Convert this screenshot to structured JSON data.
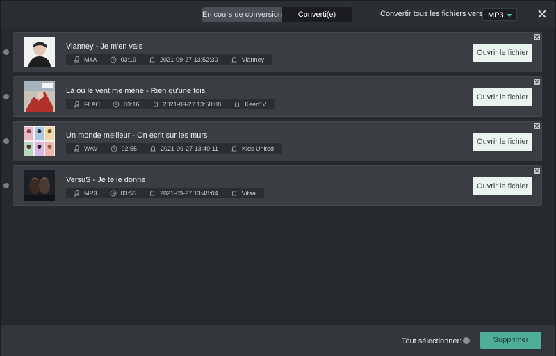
{
  "header": {
    "tabs": [
      {
        "label": "En cours de conversion",
        "active": false
      },
      {
        "label": "Converti(e)",
        "active": true
      }
    ],
    "convert_all_label": "Convertir tous les fichiers vers:",
    "format": "MP3",
    "accent": "#4fc3a0"
  },
  "items": [
    {
      "title": "Vianney - Je m'en vais",
      "format": "M4A",
      "duration": "03:19",
      "date": "2021-09-27 13:52:30",
      "artist": "Vianney",
      "open_label": "Ouvrir le fichier"
    },
    {
      "title": "Là où le vent me mène - Rien qu'une fois",
      "format": "FLAC",
      "duration": "03:16",
      "date": "2021-09-27 13:50:08",
      "artist": "Keen' V",
      "open_label": "Ouvrir le fichier"
    },
    {
      "title": "Un monde meilleur - On écrit sur les murs",
      "format": "WAV",
      "duration": "02:55",
      "date": "2021-09-27 13:49:11",
      "artist": "Kids United",
      "open_label": "Ouvrir le fichier"
    },
    {
      "title": "VersuS - Je te le donne",
      "format": "MP3",
      "duration": "03:55",
      "date": "2021-09-27 13:48:04",
      "artist": "Vitaa",
      "open_label": "Ouvrir le fichier"
    }
  ],
  "footer": {
    "select_all_label": "Tout sélectionner:",
    "delete_label": "Supprimer",
    "delete_color": "#4fae97"
  }
}
